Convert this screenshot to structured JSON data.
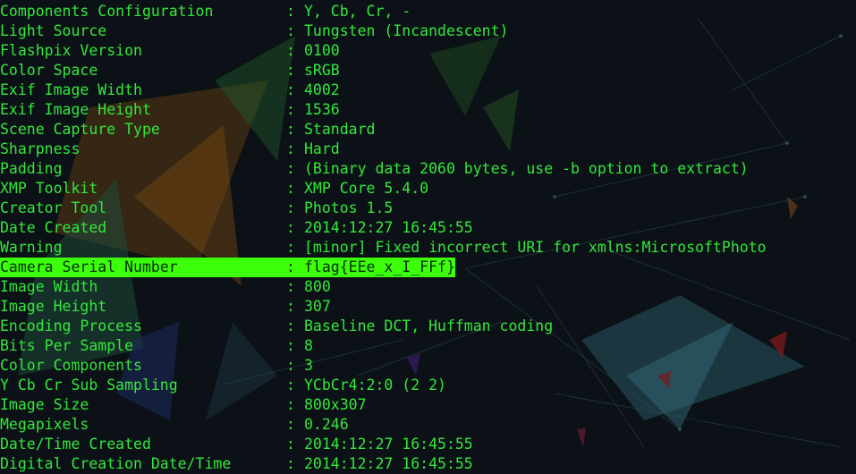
{
  "colors": {
    "background": "#0b1116",
    "text": "#33e83a",
    "highlight_background": "#3cff0a",
    "highlight_text": "#062a06"
  },
  "separator": ":",
  "rows": [
    {
      "tag": "Components Configuration",
      "value": "Y, Cb, Cr, -"
    },
    {
      "tag": "Light Source",
      "value": "Tungsten (Incandescent)"
    },
    {
      "tag": "Flashpix Version",
      "value": "0100"
    },
    {
      "tag": "Color Space",
      "value": "sRGB"
    },
    {
      "tag": "Exif Image Width",
      "value": "4002"
    },
    {
      "tag": "Exif Image Height",
      "value": "1536"
    },
    {
      "tag": "Scene Capture Type",
      "value": "Standard"
    },
    {
      "tag": "Sharpness",
      "value": "Hard"
    },
    {
      "tag": "Padding",
      "value": "(Binary data 2060 bytes, use -b option to extract)"
    },
    {
      "tag": "XMP Toolkit",
      "value": "XMP Core 5.4.0"
    },
    {
      "tag": "Creator Tool",
      "value": "Photos 1.5"
    },
    {
      "tag": "Date Created",
      "value": "2014:12:27 16:45:55"
    },
    {
      "tag": "Warning",
      "value": "[minor] Fixed incorrect URI for xmlns:MicrosoftPhoto"
    },
    {
      "tag": "Camera Serial Number",
      "value": "flag{EEe_x_I_FFf}"
    },
    {
      "tag": "Image Width",
      "value": "800"
    },
    {
      "tag": "Image Height",
      "value": "307"
    },
    {
      "tag": "Encoding Process",
      "value": "Baseline DCT, Huffman coding"
    },
    {
      "tag": "Bits Per Sample",
      "value": "8"
    },
    {
      "tag": "Color Components",
      "value": "3"
    },
    {
      "tag": "Y Cb Cr Sub Sampling",
      "value": "YCbCr4:2:0 (2 2)"
    },
    {
      "tag": "Image Size",
      "value": "800x307"
    },
    {
      "tag": "Megapixels",
      "value": "0.246"
    },
    {
      "tag": "Date/Time Created",
      "value": "2014:12:27 16:45:55"
    },
    {
      "tag": "Digital Creation Date/Time",
      "value": "2014:12:27 16:45:55"
    }
  ]
}
